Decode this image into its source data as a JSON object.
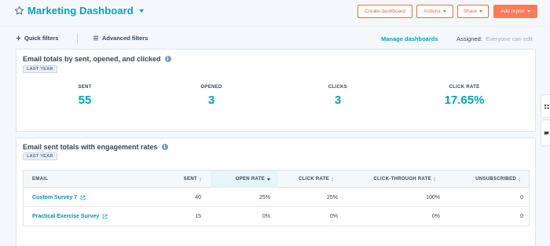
{
  "header": {
    "title": "Marketing Dashboard",
    "buttons": {
      "create": "Create dashboard",
      "actions": "Actions",
      "share": "Share",
      "add_report": "Add report"
    }
  },
  "filters": {
    "quick": "Quick filters",
    "advanced": "Advanced filters",
    "manage": "Manage dashboards",
    "assigned_label": "Assigned:",
    "assigned_value": "Everyone can edit"
  },
  "card1": {
    "title": "Email totals by sent, opened, and clicked",
    "period": "LAST YEAR",
    "kpis": [
      {
        "label": "SENT",
        "value": "55"
      },
      {
        "label": "OPENED",
        "value": "3"
      },
      {
        "label": "CLICKS",
        "value": "3"
      },
      {
        "label": "CLICK RATE",
        "value": "17.65%"
      }
    ]
  },
  "card2": {
    "title": "Email sent totals with engagement rates",
    "period": "LAST YEAR",
    "columns": [
      "EMAIL",
      "SENT",
      "OPEN RATE",
      "CLICK RATE",
      "CLICK-THROUGH RATE",
      "UNSUBSCRIBED"
    ],
    "rows": [
      {
        "email": "Custom Survey 7",
        "sent": "40",
        "open_rate": "25%",
        "click_rate": "25%",
        "ctr": "100%",
        "unsub": "0"
      },
      {
        "email": "Practical Exercise Survey",
        "sent": "15",
        "open_rate": "0%",
        "click_rate": "0%",
        "ctr": "0%",
        "unsub": "0"
      }
    ]
  },
  "colors": {
    "accent": "#00a4bd",
    "primary_button": "#ff7a59",
    "link": "#0091ae"
  }
}
